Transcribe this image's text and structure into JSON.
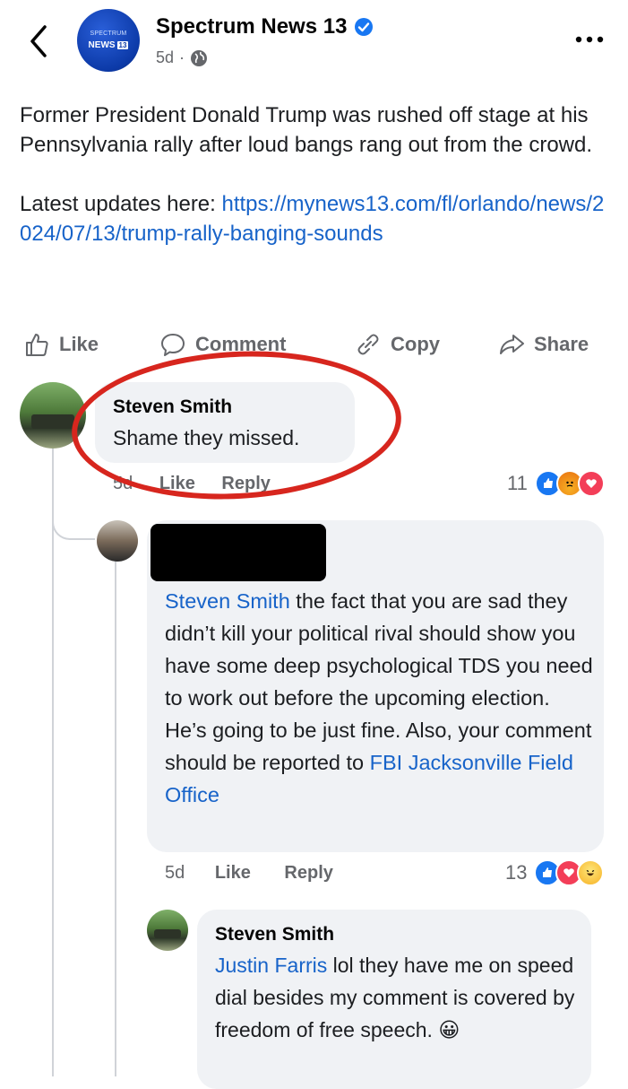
{
  "header": {
    "page_name": "Spectrum News 13",
    "logo_line1": "SPECTRUM",
    "logo_line2": "NEWS",
    "logo_number": "13",
    "age": "5d",
    "separator": "·"
  },
  "post": {
    "text_line": "Former President Donald Trump was rushed off stage at his Pennsylvania rally after loud bangs rang out from the crowd.",
    "updates_prefix": "Latest updates here: ",
    "updates_link": "https://mynews13.com/fl/orlando/news/2024/07/13/trump-rally-banging-sounds"
  },
  "actions": {
    "like": "Like",
    "comment": "Comment",
    "copy": "Copy",
    "share": "Share"
  },
  "comments": [
    {
      "author": "Steven Smith",
      "text": "Shame they missed.",
      "age": "5d",
      "like": "Like",
      "reply": "Reply",
      "reaction_count": "11",
      "reactions": [
        "like",
        "angry",
        "love"
      ]
    },
    {
      "author": "",
      "mention": "Steven Smith",
      "text": " the fact that you are sad they didn’t kill your political rival should show you have some deep psychological TDS you need to work out before the upcoming election. He’s going to be just fine. Also, your comment should be reported to ",
      "link": "FBI Jacksonville Field Office",
      "age": "5d",
      "like": "Like",
      "reply": "Reply",
      "reaction_count": "13",
      "reactions": [
        "like",
        "love",
        "haha"
      ]
    },
    {
      "author": "Steven Smith",
      "mention": "Justin Farris",
      "text": " lol they have me on speed dial besides my comment is covered by freedom of free speech. ",
      "emoji": "😀"
    }
  ],
  "colors": {
    "link": "#1763c9",
    "annotation": "#d7261e",
    "bubble": "#f0f2f5"
  }
}
